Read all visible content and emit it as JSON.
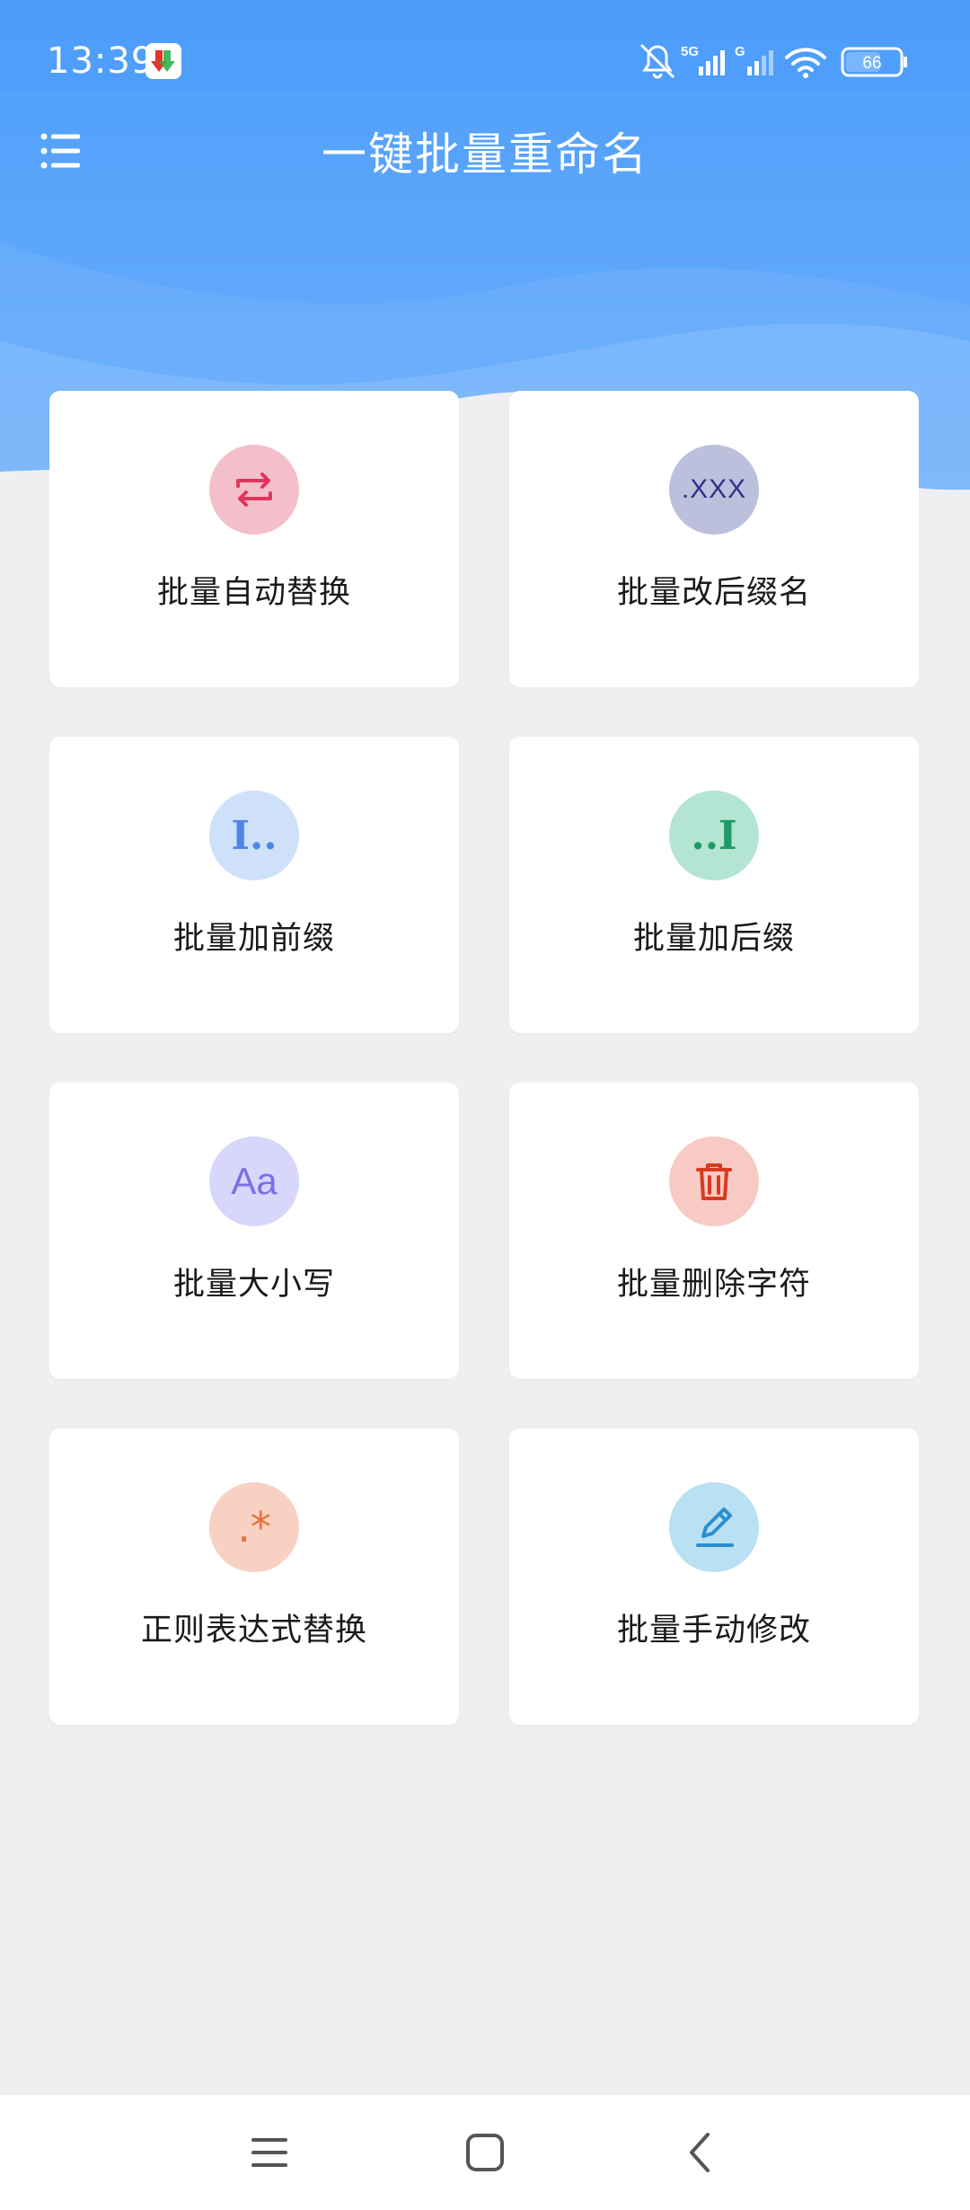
{
  "status_bar": {
    "time": "13:39",
    "network": "5G",
    "network2": "G",
    "battery": "66"
  },
  "app_bar": {
    "title": "一键批量重命名",
    "menu_icon": "list-menu-icon"
  },
  "colors": {
    "header_blue": "#4f9ffb",
    "background": "#efeff1"
  },
  "cards": [
    {
      "label": "批量自动替换",
      "icon": "swap-arrows-icon",
      "bg": "#f4bfcb",
      "fg": "#e0365d"
    },
    {
      "label": "批量改后缀名",
      "icon": "extension-xxx-icon",
      "icon_text": ".XXX",
      "bg": "#bcc0dc",
      "fg": "#2c3387"
    },
    {
      "label": "批量加前缀",
      "icon": "prefix-icon",
      "icon_text": "I..",
      "bg": "#cfe0fb",
      "fg": "#4f86e6"
    },
    {
      "label": "批量加后缀",
      "icon": "suffix-icon",
      "icon_text": "..I",
      "bg": "#b4e4d2",
      "fg": "#1e9a66"
    },
    {
      "label": "批量大小写",
      "icon": "letter-case-icon",
      "icon_text": "Aa",
      "bg": "#d9d6fb",
      "fg": "#7a6fe6"
    },
    {
      "label": "批量删除字符",
      "icon": "trash-icon",
      "bg": "#f8cac4",
      "fg": "#d93a22"
    },
    {
      "label": "正则表达式替换",
      "icon": "regex-icon",
      "icon_text": ".*",
      "bg": "#f8d1c2",
      "fg": "#e8703f"
    },
    {
      "label": "批量手动修改",
      "icon": "pencil-edit-icon",
      "bg": "#b9e0f3",
      "fg": "#2a8fd0"
    }
  ],
  "nav": {
    "recents": "recents-icon",
    "home": "home-icon",
    "back": "back-icon"
  }
}
